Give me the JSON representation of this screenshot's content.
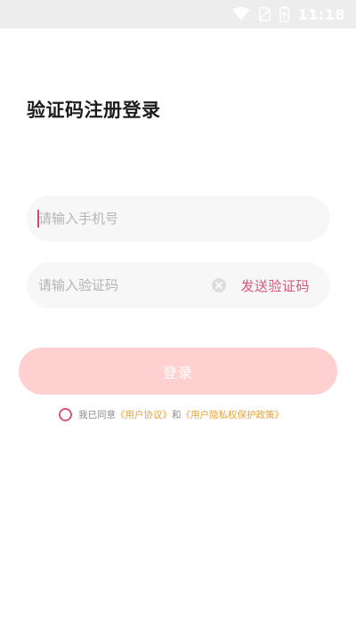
{
  "status_bar": {
    "time": "11:18",
    "icons": [
      "wifi-icon",
      "no-sim-icon",
      "battery-charging-icon"
    ]
  },
  "login": {
    "title": "验证码注册登录",
    "phone_placeholder": "请输入手机号",
    "code_placeholder": "请输入验证码",
    "send_code_label": "发送验证码",
    "login_button_label": "登录"
  },
  "agreement": {
    "prefix": "我已同意",
    "user_agreement_link": "《用户协议》",
    "conjunction": "和",
    "privacy_policy_link": "《用户隐私权保护政策》"
  },
  "colors": {
    "accent": "#d8557c",
    "button_disabled": "#ffd0d0",
    "link": "#e8a33d",
    "field_background": "#f7f7f7"
  }
}
